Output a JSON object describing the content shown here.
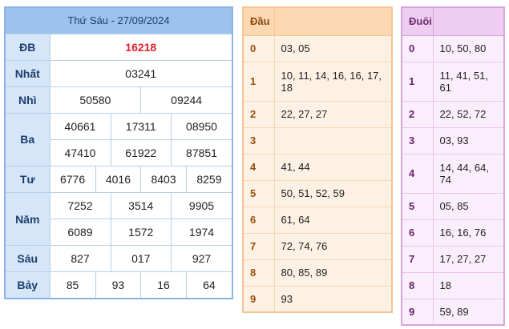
{
  "header": {
    "title": "Thứ Sáu - 27/09/2024"
  },
  "prizes": {
    "db": {
      "label": "ĐB",
      "values": [
        "16218"
      ]
    },
    "nhat": {
      "label": "Nhất",
      "values": [
        "03241"
      ]
    },
    "nhi": {
      "label": "Nhì",
      "values": [
        "50580",
        "09244"
      ]
    },
    "ba": {
      "label": "Ba",
      "values": [
        "40661",
        "17311",
        "08950",
        "47410",
        "61922",
        "87851"
      ]
    },
    "tu": {
      "label": "Tư",
      "values": [
        "6776",
        "4016",
        "8403",
        "8259"
      ]
    },
    "nam": {
      "label": "Năm",
      "values": [
        "7252",
        "3514",
        "9905",
        "6089",
        "1572",
        "1974"
      ]
    },
    "sau": {
      "label": "Sáu",
      "values": [
        "827",
        "017",
        "927"
      ]
    },
    "bay": {
      "label": "Bảy",
      "values": [
        "85",
        "93",
        "16",
        "64"
      ]
    }
  },
  "dau": {
    "header": "Đầu",
    "rows": [
      {
        "k": "0",
        "v": "03, 05"
      },
      {
        "k": "1",
        "v": "10, 11, 14, 16, 16, 17, 18"
      },
      {
        "k": "2",
        "v": "22, 27, 27"
      },
      {
        "k": "3",
        "v": ""
      },
      {
        "k": "4",
        "v": "41, 44"
      },
      {
        "k": "5",
        "v": "50, 51, 52, 59"
      },
      {
        "k": "6",
        "v": "61, 64"
      },
      {
        "k": "7",
        "v": "72, 74, 76"
      },
      {
        "k": "8",
        "v": "80, 85, 89"
      },
      {
        "k": "9",
        "v": "93"
      }
    ]
  },
  "duoi": {
    "header": "Đuôi",
    "rows": [
      {
        "k": "0",
        "v": "10, 50, 80"
      },
      {
        "k": "1",
        "v": "11, 41, 51, 61"
      },
      {
        "k": "2",
        "v": "22, 52, 72"
      },
      {
        "k": "3",
        "v": "03, 93"
      },
      {
        "k": "4",
        "v": "14, 44, 64, 74"
      },
      {
        "k": "5",
        "v": "05, 85"
      },
      {
        "k": "6",
        "v": "16, 16, 76"
      },
      {
        "k": "7",
        "v": "17, 27, 27"
      },
      {
        "k": "8",
        "v": "18"
      },
      {
        "k": "9",
        "v": "59, 89"
      }
    ]
  },
  "colors": {
    "special": "#e4202a",
    "main_border": "#8bb3e8",
    "dau_border": "#f6c593",
    "duoi_border": "#d7a6db"
  }
}
